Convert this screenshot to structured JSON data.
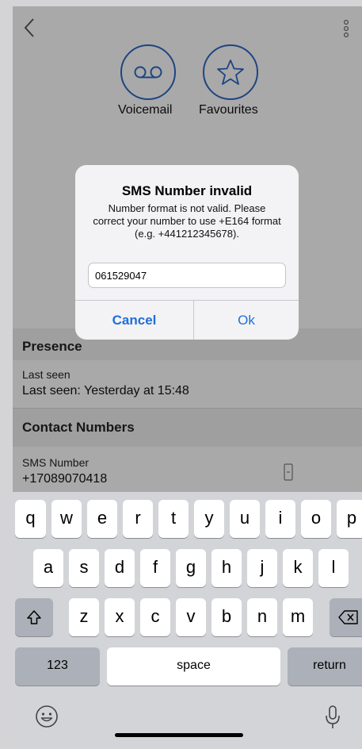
{
  "header": {
    "actions": [
      {
        "label": "Voicemail",
        "icon": "voicemail-icon"
      },
      {
        "label": "Favourites",
        "icon": "star-icon"
      }
    ]
  },
  "presence": {
    "title": "Presence",
    "last_seen_label": "Last seen",
    "last_seen_value": "Last seen: Yesterday at 15:48"
  },
  "contact_numbers": {
    "title": "Contact Numbers",
    "sms_label": "SMS Number",
    "sms_value": "+17089070418"
  },
  "alert": {
    "title": "SMS Number invalid",
    "message": "Number format is not valid. Please correct your number to use +E164 format (e.g. +441212345678).",
    "input_value": "061529047",
    "cancel_label": "Cancel",
    "ok_label": "Ok"
  },
  "keyboard": {
    "row1": [
      "q",
      "w",
      "e",
      "r",
      "t",
      "y",
      "u",
      "i",
      "o",
      "p"
    ],
    "row2": [
      "a",
      "s",
      "d",
      "f",
      "g",
      "h",
      "j",
      "k",
      "l"
    ],
    "row3": [
      "z",
      "x",
      "c",
      "v",
      "b",
      "n",
      "m"
    ],
    "numbers_label": "123",
    "space_label": "space",
    "return_label": "return"
  },
  "colors": {
    "accent": "#1f6fd6",
    "circle_border": "#2c63b8"
  }
}
